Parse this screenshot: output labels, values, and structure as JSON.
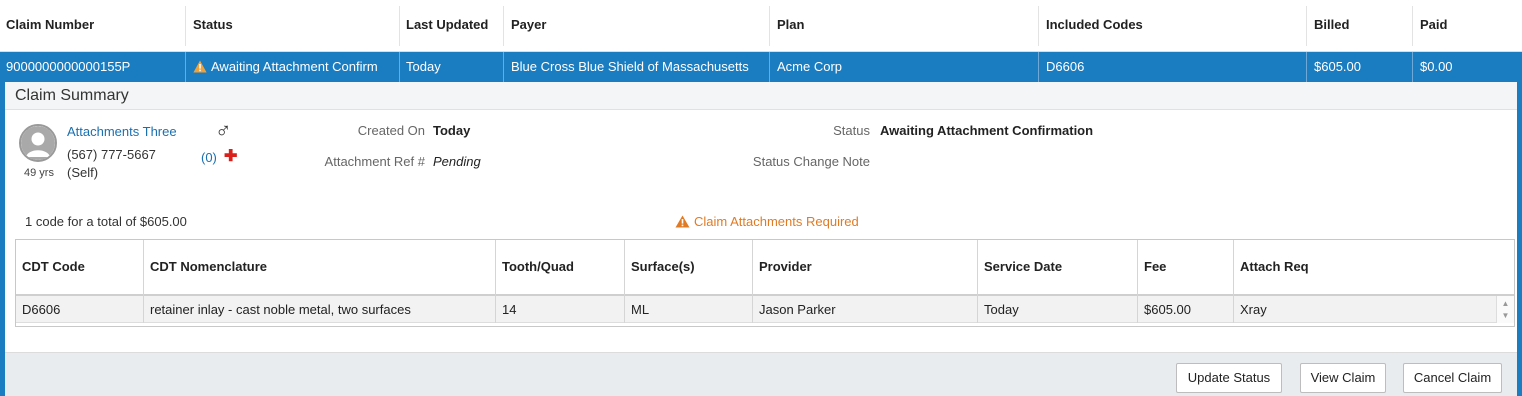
{
  "header": {
    "columns": [
      "Claim Number",
      "Status",
      "Last Updated",
      "Payer",
      "Plan",
      "Included Codes",
      "Billed",
      "Paid"
    ]
  },
  "claim_row": {
    "claim_number": "9000000000000155P",
    "status": "Awaiting Attachment Confirm",
    "last_updated": "Today",
    "payer": "Blue Cross Blue Shield of Massachusetts",
    "plan": "Acme Corp",
    "included_codes": "D6606",
    "billed": "$605.00",
    "paid": "$0.00",
    "status_icon": "warning-icon"
  },
  "summary": {
    "title": "Claim Summary",
    "patient": {
      "name": "Attachments Three",
      "phone": "(567) 777-5667",
      "relationship": "(Self)",
      "age": "49 yrs",
      "gender_symbol": "♂",
      "attachments_count": "(0)",
      "add_icon": "plus-icon"
    },
    "created_on_label": "Created On",
    "created_on_value": "Today",
    "attachment_ref_label": "Attachment Ref #",
    "attachment_ref_value": "Pending",
    "status_label": "Status",
    "status_value": "Awaiting Attachment Confirmation",
    "status_change_note_label": "Status Change Note",
    "total_text": "1 code for a total of $605.00",
    "warning_text": "Claim Attachments Required",
    "warning_color": "#e07b24"
  },
  "codes_table": {
    "columns": [
      "CDT Code",
      "CDT Nomenclature",
      "Tooth/Quad",
      "Surface(s)",
      "Provider",
      "Service Date",
      "Fee",
      "Attach Req"
    ],
    "rows": [
      [
        "D6606",
        "retainer inlay - cast noble metal, two surfaces",
        "14",
        "ML",
        "Jason Parker",
        "Today",
        "$605.00",
        "Xray"
      ]
    ]
  },
  "buttons": {
    "update_status": "Update Status",
    "view_claim": "View Claim",
    "cancel_claim": "Cancel Claim"
  },
  "colors": {
    "accent": "#1a7cc1",
    "warning": "#e07b24",
    "attach_req": "#e0362b"
  }
}
